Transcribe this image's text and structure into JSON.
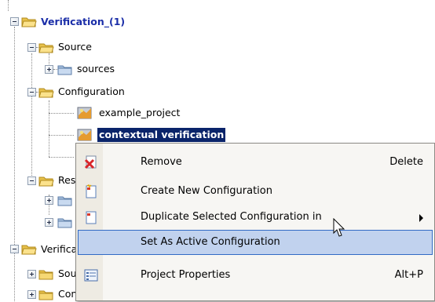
{
  "tree": {
    "root": {
      "label": "Verification_(1)"
    },
    "source": {
      "label": "Source"
    },
    "sources": {
      "label": "sources"
    },
    "configuration": {
      "label": "Configuration"
    },
    "config_items": [
      {
        "label": "example_project"
      },
      {
        "label": "contextual verification"
      }
    ],
    "res_partial": {
      "label": "Res"
    },
    "second_root": {
      "label": "Verifica"
    },
    "second_source": {
      "label": "Sou"
    },
    "second_configuration": {
      "label": "Configuration"
    }
  },
  "context_menu": {
    "items": [
      {
        "label": "Remove",
        "shortcut": "Delete",
        "icon": "remove-x-icon"
      },
      {
        "label": "Create New Configuration",
        "icon": "new-config-icon"
      },
      {
        "label": "Duplicate Selected Configuration in",
        "icon": "duplicate-config-icon",
        "submenu": true
      },
      {
        "label": "Set As Active Configuration",
        "highlighted": true
      },
      {
        "label": "Project Properties",
        "shortcut": "Alt+P",
        "icon": "properties-icon"
      }
    ]
  },
  "colors": {
    "selection": "#0a246a",
    "root_label": "#1b2ea8",
    "menu_highlight": "#c1d2ee",
    "folder": "#f3d36b"
  }
}
